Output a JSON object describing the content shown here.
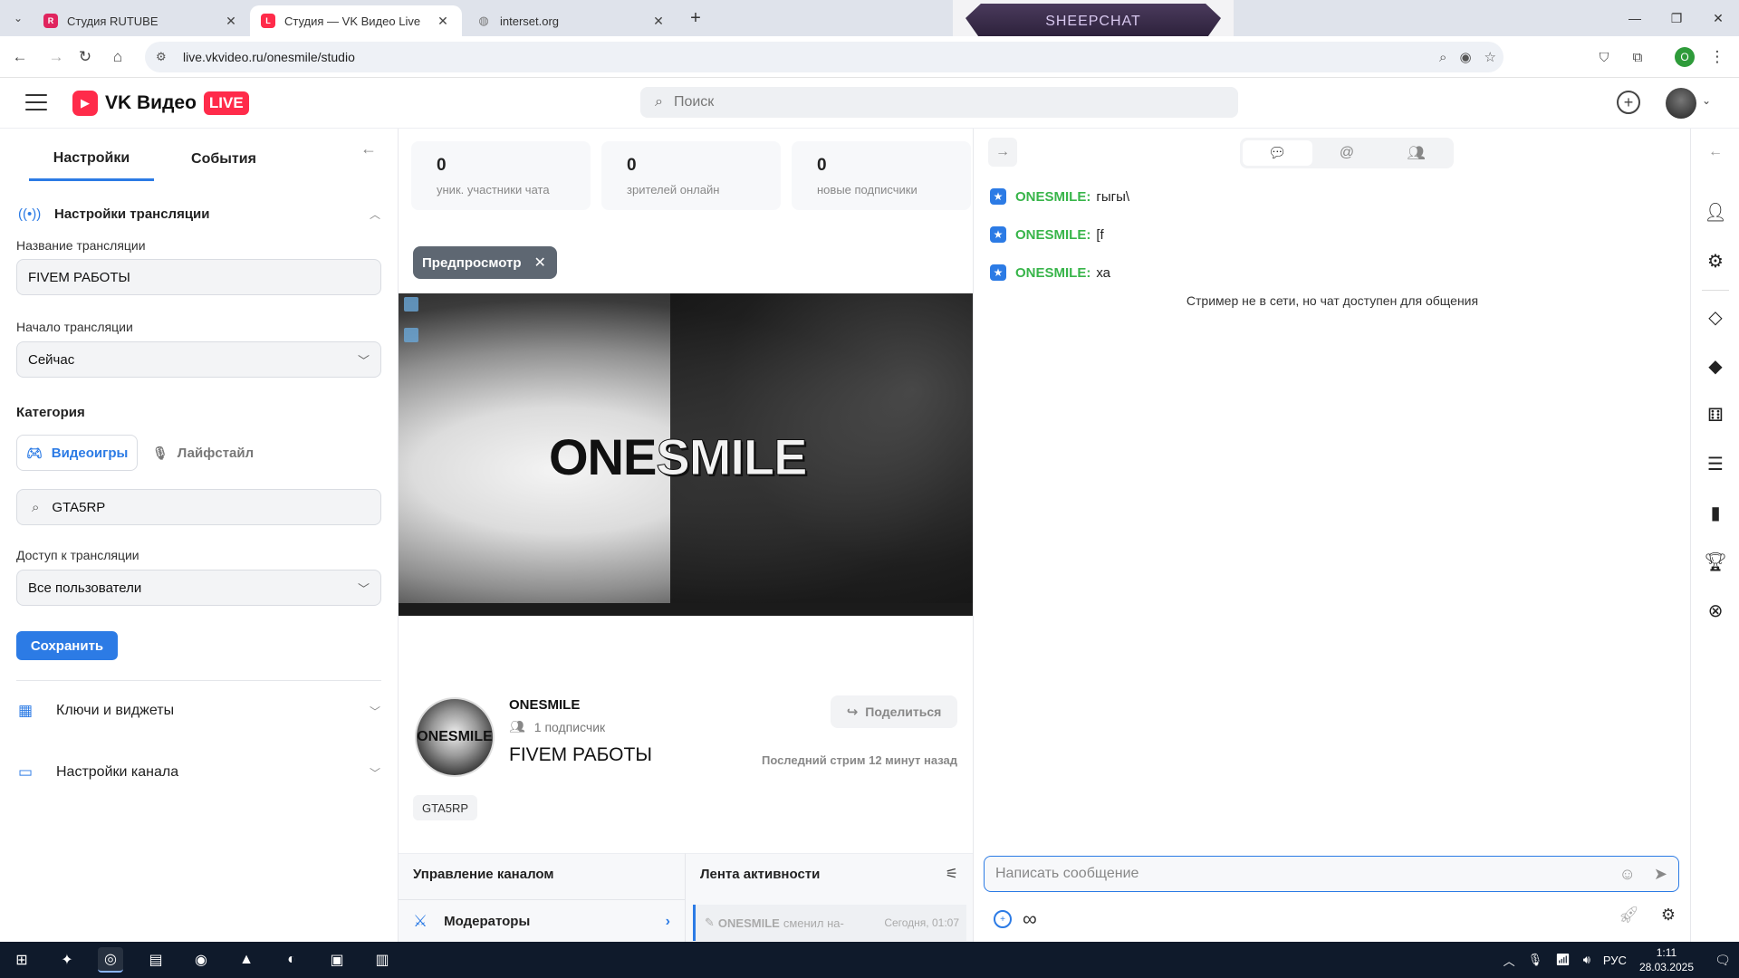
{
  "browser": {
    "tabs": [
      {
        "title": "Студия RUTUBE",
        "favicon": "rutube-icon",
        "color": "#e0245e"
      },
      {
        "title": "Студия — VK Видео Live",
        "favicon": "vk-live-icon",
        "color": "#ff2b4a"
      },
      {
        "title": "interset.org",
        "favicon": "globe-icon",
        "color": "#777777"
      }
    ],
    "url": "live.vkvideo.ru/onesmile/studio",
    "profile_initial": "O",
    "overlay_banner": "SHEEPCHAT"
  },
  "header": {
    "logo_text": "VK Видео",
    "logo_badge": "LIVE",
    "search_placeholder": "Поиск"
  },
  "left": {
    "tabs": [
      "Настройки",
      "События"
    ],
    "section_title": "Настройки трансляции",
    "title_label": "Название трансляции",
    "title_value": "FIVEM РАБОТЫ",
    "start_label": "Начало трансляции",
    "start_value": "Сейчас",
    "category_label": "Категория",
    "category_games": "Видеоигры",
    "category_life": "Лайфстайл",
    "category_search_value": "GTA5RP",
    "access_label": "Доступ к трансляции",
    "access_value": "Все пользователи",
    "save_label": "Сохранить",
    "keys_label": "Ключи и виджеты",
    "channel_label": "Настройки канала"
  },
  "stats": [
    {
      "value": "0",
      "caption": "уник. участники чата"
    },
    {
      "value": "0",
      "caption": "зрителей онлайн"
    },
    {
      "value": "0",
      "caption": "новые подписчики"
    }
  ],
  "preview": {
    "chip_label": "Предпросмотр",
    "brand_left": "ONE",
    "brand_right": "SMILE"
  },
  "channel": {
    "avatar_text": "ONESMILE",
    "name": "ONESMILE",
    "subscribers": "1 подписчик",
    "stream_title": "FIVEM РАБОТЫ",
    "share_label": "Поделиться",
    "last_stream": "Последний стрим 12 минут назад",
    "tag": "GTA5RP"
  },
  "management": {
    "title": "Управление каналом",
    "item": "Модераторы"
  },
  "feed": {
    "title": "Лента активности",
    "entry_author": "ONESMILE",
    "entry_text": "сменил на-",
    "entry_time": "Сегодня, 01:07"
  },
  "chat": {
    "messages": [
      {
        "author": "ONESMILE:",
        "text": "гыгы\\"
      },
      {
        "author": "ONESMILE:",
        "text": "[f"
      },
      {
        "author": "ONESMILE:",
        "text": "ха"
      }
    ],
    "offline_note": "Стример не в сети, но чат доступен для общения",
    "input_placeholder": "Написать сообщение"
  },
  "taskbar": {
    "language": "РУС",
    "time": "1:11",
    "date": "28.03.2025"
  },
  "colors": {
    "accent": "#2c7be5",
    "brand_red": "#ff2b4a",
    "chat_author": "#38b54a"
  }
}
